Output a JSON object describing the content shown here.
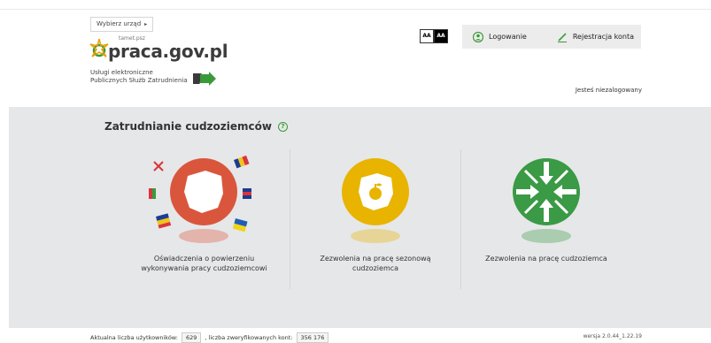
{
  "header": {
    "office_button": "Wybierz urząd",
    "logo_small": "tamet.psz",
    "logo_text": "praca.gov.pl",
    "services_line1": "Usługi elektroniczne",
    "services_line2": "Publicznych Służb Zatrudnienia",
    "contrast_normal": "AA",
    "contrast_high": "AA",
    "login": "Logowanie",
    "register": "Rejestracja konta",
    "status": "Jesteś niezalogowany"
  },
  "main": {
    "title": "Zatrudnianie cudzoziemców",
    "cards": [
      {
        "line1": "Oświadczenia o powierzeniu",
        "line2": "wykonywania pracy cudzoziemcowi",
        "icon": "poland-map-flags-icon"
      },
      {
        "line1": "Zezwolenia na pracę sezonową",
        "line2": "cudzoziemca",
        "icon": "apple-map-icon"
      },
      {
        "line1": "Zezwolenia na pracę cudzoziemca",
        "line2": "",
        "icon": "arrows-inward-icon"
      }
    ]
  },
  "footer": {
    "users_label": "Aktualna liczba użytkowników:",
    "users_count": "629",
    "accounts_label": ", liczba zweryfikowanych kont:",
    "accounts_count": "356 176",
    "version": "wersja 2.0.44_1.22.19"
  },
  "colors": {
    "accent_green": "#3a9a3a",
    "card1": "#d9563c",
    "card2": "#e8b400",
    "card3": "#3a9a45",
    "panel": "#e6e7e9"
  }
}
